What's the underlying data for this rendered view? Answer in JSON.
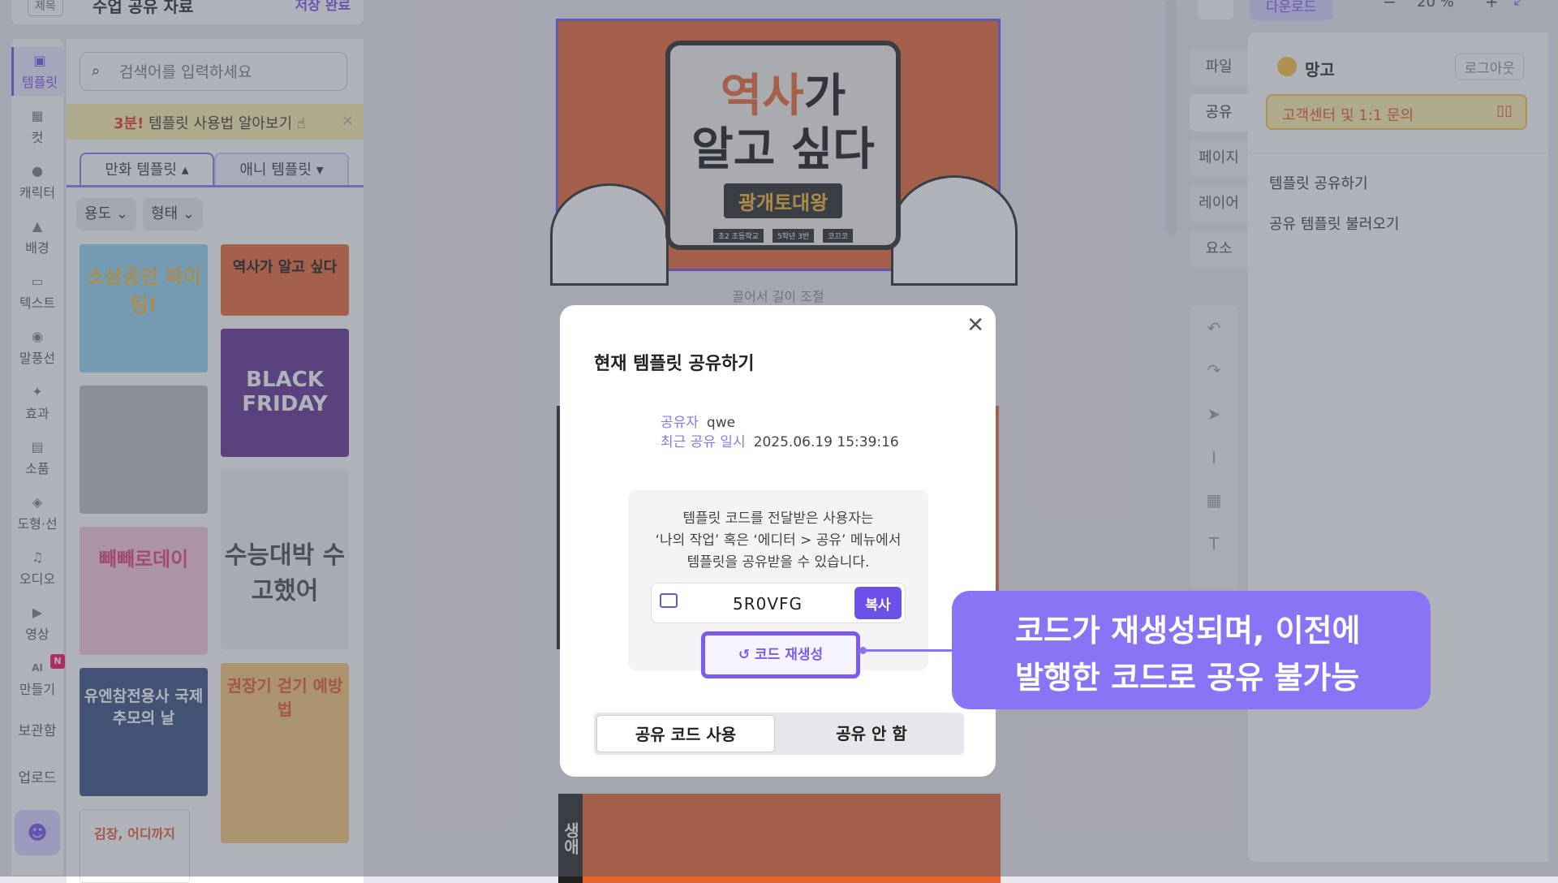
{
  "header": {
    "tag": "제목",
    "title": "수업 공유 자료",
    "status": "저장 완료"
  },
  "rail": {
    "items": [
      {
        "label": "템플릿",
        "icon": "template-icon"
      },
      {
        "label": "컷",
        "icon": "cut-icon"
      },
      {
        "label": "캐릭터",
        "icon": "character-icon"
      },
      {
        "label": "배경",
        "icon": "background-icon"
      },
      {
        "label": "텍스트",
        "icon": "text-icon"
      },
      {
        "label": "말풍선",
        "icon": "speech-bubble-icon"
      },
      {
        "label": "효과",
        "icon": "effect-icon"
      },
      {
        "label": "소품",
        "icon": "props-icon"
      },
      {
        "label": "도형·선",
        "icon": "shape-icon"
      },
      {
        "label": "오디오",
        "icon": "audio-icon"
      },
      {
        "label": "영상",
        "icon": "video-icon"
      },
      {
        "label": "만들기",
        "icon": "ai-icon",
        "badge": "N",
        "prefix": "AI"
      }
    ],
    "storage": "보관함",
    "upload": "업로드"
  },
  "panel": {
    "search_placeholder": "검색어를 입력하세요",
    "banner": {
      "highlight": "3분!",
      "text": " 템플릿 사용법 알아보기"
    },
    "tabs": [
      {
        "label": "만화 템플릿 ▴"
      },
      {
        "label": "애니 템플릿 ▾"
      }
    ],
    "filters": [
      {
        "label": "용도 ⌄"
      },
      {
        "label": "형태 ⌄"
      }
    ],
    "thumbs": [
      {
        "text": "소상공인 파이팅!"
      },
      {
        "text": "역사가 알고 싶다"
      },
      {
        "text": "BLACK FRIDAY"
      },
      {
        "text": "수능대박 수고했어"
      },
      {
        "text": "빼빼로데이"
      },
      {
        "text": "유엔참전용사 국제추모의 날"
      },
      {
        "text": "김장, 어디까지"
      },
      {
        "text": "권장기 걷기 예방법"
      }
    ]
  },
  "canvas": {
    "title_orange": "역사",
    "title_rest": "가",
    "title_line2": "알고 싶다",
    "pill": "광개토대왕",
    "tags": [
      "초2 초등학교",
      "5학년 3반",
      "코끄코"
    ],
    "resize_hint": "끌어서 길이 조절",
    "bottom_side": "생애"
  },
  "right_tabs": [
    "파일",
    "공유",
    "페이지",
    "레이어",
    "요소"
  ],
  "right_panel": {
    "user": "망고",
    "logout": "로그아웃",
    "support": "고객센터 및 1:1 문의",
    "menu": [
      "템플릿 공유하기",
      "공유 템플릿 불러오기"
    ]
  },
  "top_right": {
    "download": "다운로드",
    "zoom": "20 %"
  },
  "modal": {
    "title": "현재 템플릿 공유하기",
    "sharer_label": "공유자",
    "sharer_value": "qwe",
    "recent_label": "최근 공유 일시",
    "recent_value": "2025.06.19 15:39:16",
    "desc_line1": "템플릿 코드를 전달받은 사용자는",
    "desc_line2": "‘나의 작업’ 혹은 ‘에디터 > 공유’ 메뉴에서",
    "desc_line3": "템플릿을 공유받을 수 있습니다.",
    "code": "5R0VFG",
    "copy_label": "복사",
    "regen_label": "코드 재생성",
    "option_use": "공유 코드 사용",
    "option_none": "공유 안 함"
  },
  "callout": {
    "line1": "코드가 재생성되며, 이전에",
    "line2": "발행한 코드로 공유 불가능"
  },
  "colors": {
    "accent": "#6d4fe9",
    "callout": "#8a73f5",
    "canvas_orange": "#e8622b",
    "banner": "#fdf0a6"
  }
}
